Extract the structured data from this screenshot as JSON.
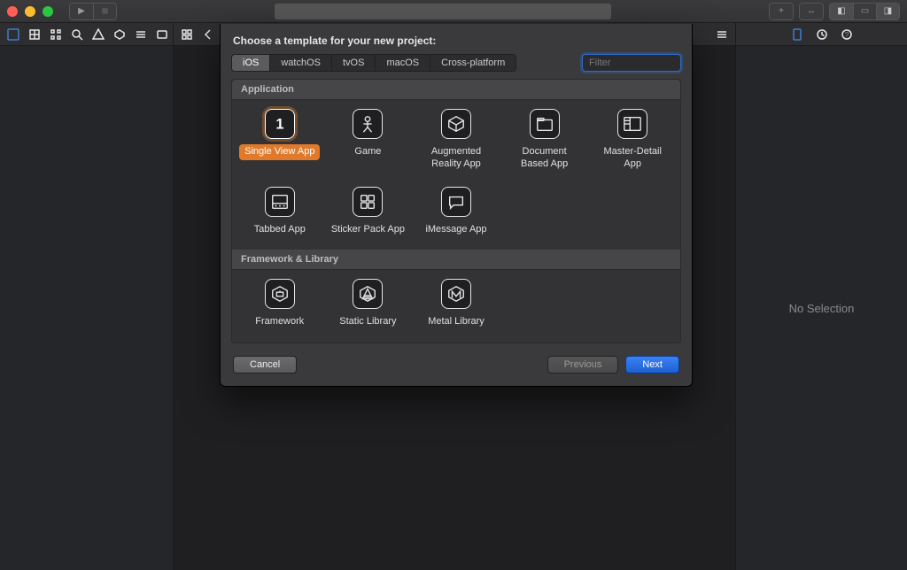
{
  "inspector": {
    "empty_text": "No Selection"
  },
  "sheet": {
    "title": "Choose a template for your new project:",
    "platforms": [
      "iOS",
      "watchOS",
      "tvOS",
      "macOS",
      "Cross-platform"
    ],
    "selected_platform": "iOS",
    "filter_placeholder": "Filter",
    "sections": {
      "app": {
        "title": "Application"
      },
      "lib": {
        "title": "Framework & Library"
      }
    },
    "templates_app": [
      {
        "label": "Single View App"
      },
      {
        "label": "Game"
      },
      {
        "label": "Augmented Reality App"
      },
      {
        "label": "Document Based App"
      },
      {
        "label": "Master-Detail App"
      },
      {
        "label": "Tabbed App"
      },
      {
        "label": "Sticker Pack App"
      },
      {
        "label": "iMessage App"
      }
    ],
    "templates_lib": [
      {
        "label": "Framework"
      },
      {
        "label": "Static Library"
      },
      {
        "label": "Metal Library"
      }
    ],
    "buttons": {
      "cancel": "Cancel",
      "previous": "Previous",
      "next": "Next"
    }
  }
}
